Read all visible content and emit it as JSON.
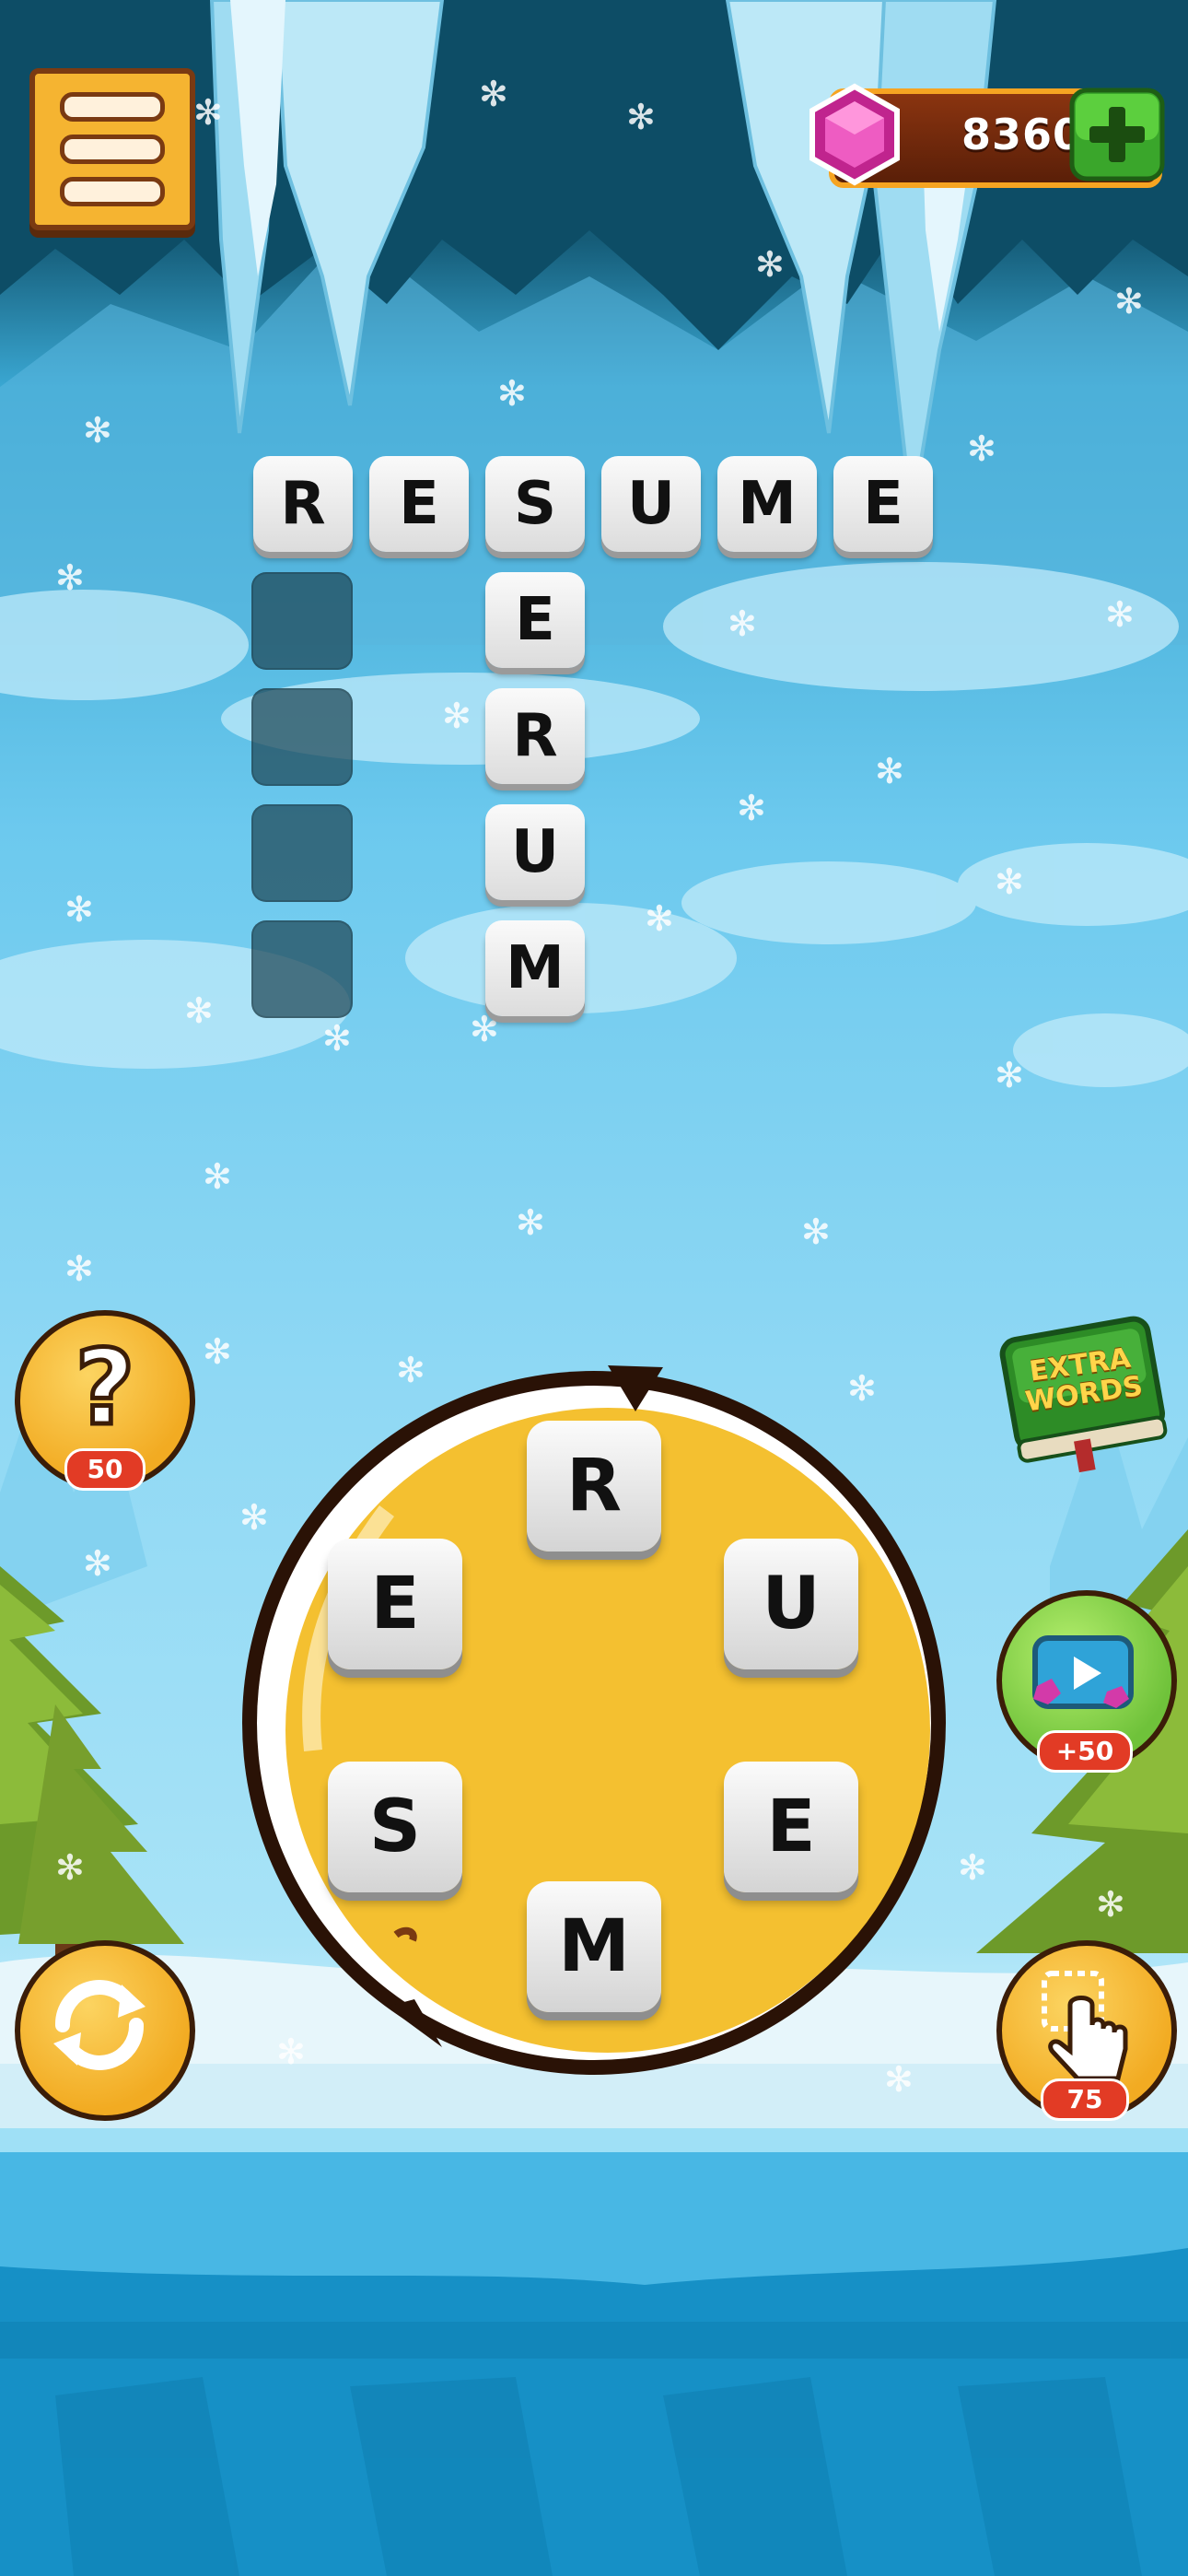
{
  "hud": {
    "gem_count": "8360"
  },
  "grid": {
    "across_word": [
      "R",
      "E",
      "S",
      "U",
      "M",
      "E"
    ],
    "down_word": [
      "E",
      "R",
      "U",
      "M"
    ],
    "empty_slots": 4
  },
  "wheel": {
    "letters": [
      "R",
      "E",
      "U",
      "S",
      "E",
      "M"
    ]
  },
  "buttons": {
    "hint_cost": "50",
    "video_reward": "+50",
    "finger_cost": "75",
    "extra_words_line1": "EXTRA",
    "extra_words_line2": "WORDS"
  },
  "colors": {
    "wheel_fill": "#f4c030",
    "wheel_border": "#2a1206",
    "badge_red": "#e23b25",
    "tile": "#e8e8e8"
  }
}
